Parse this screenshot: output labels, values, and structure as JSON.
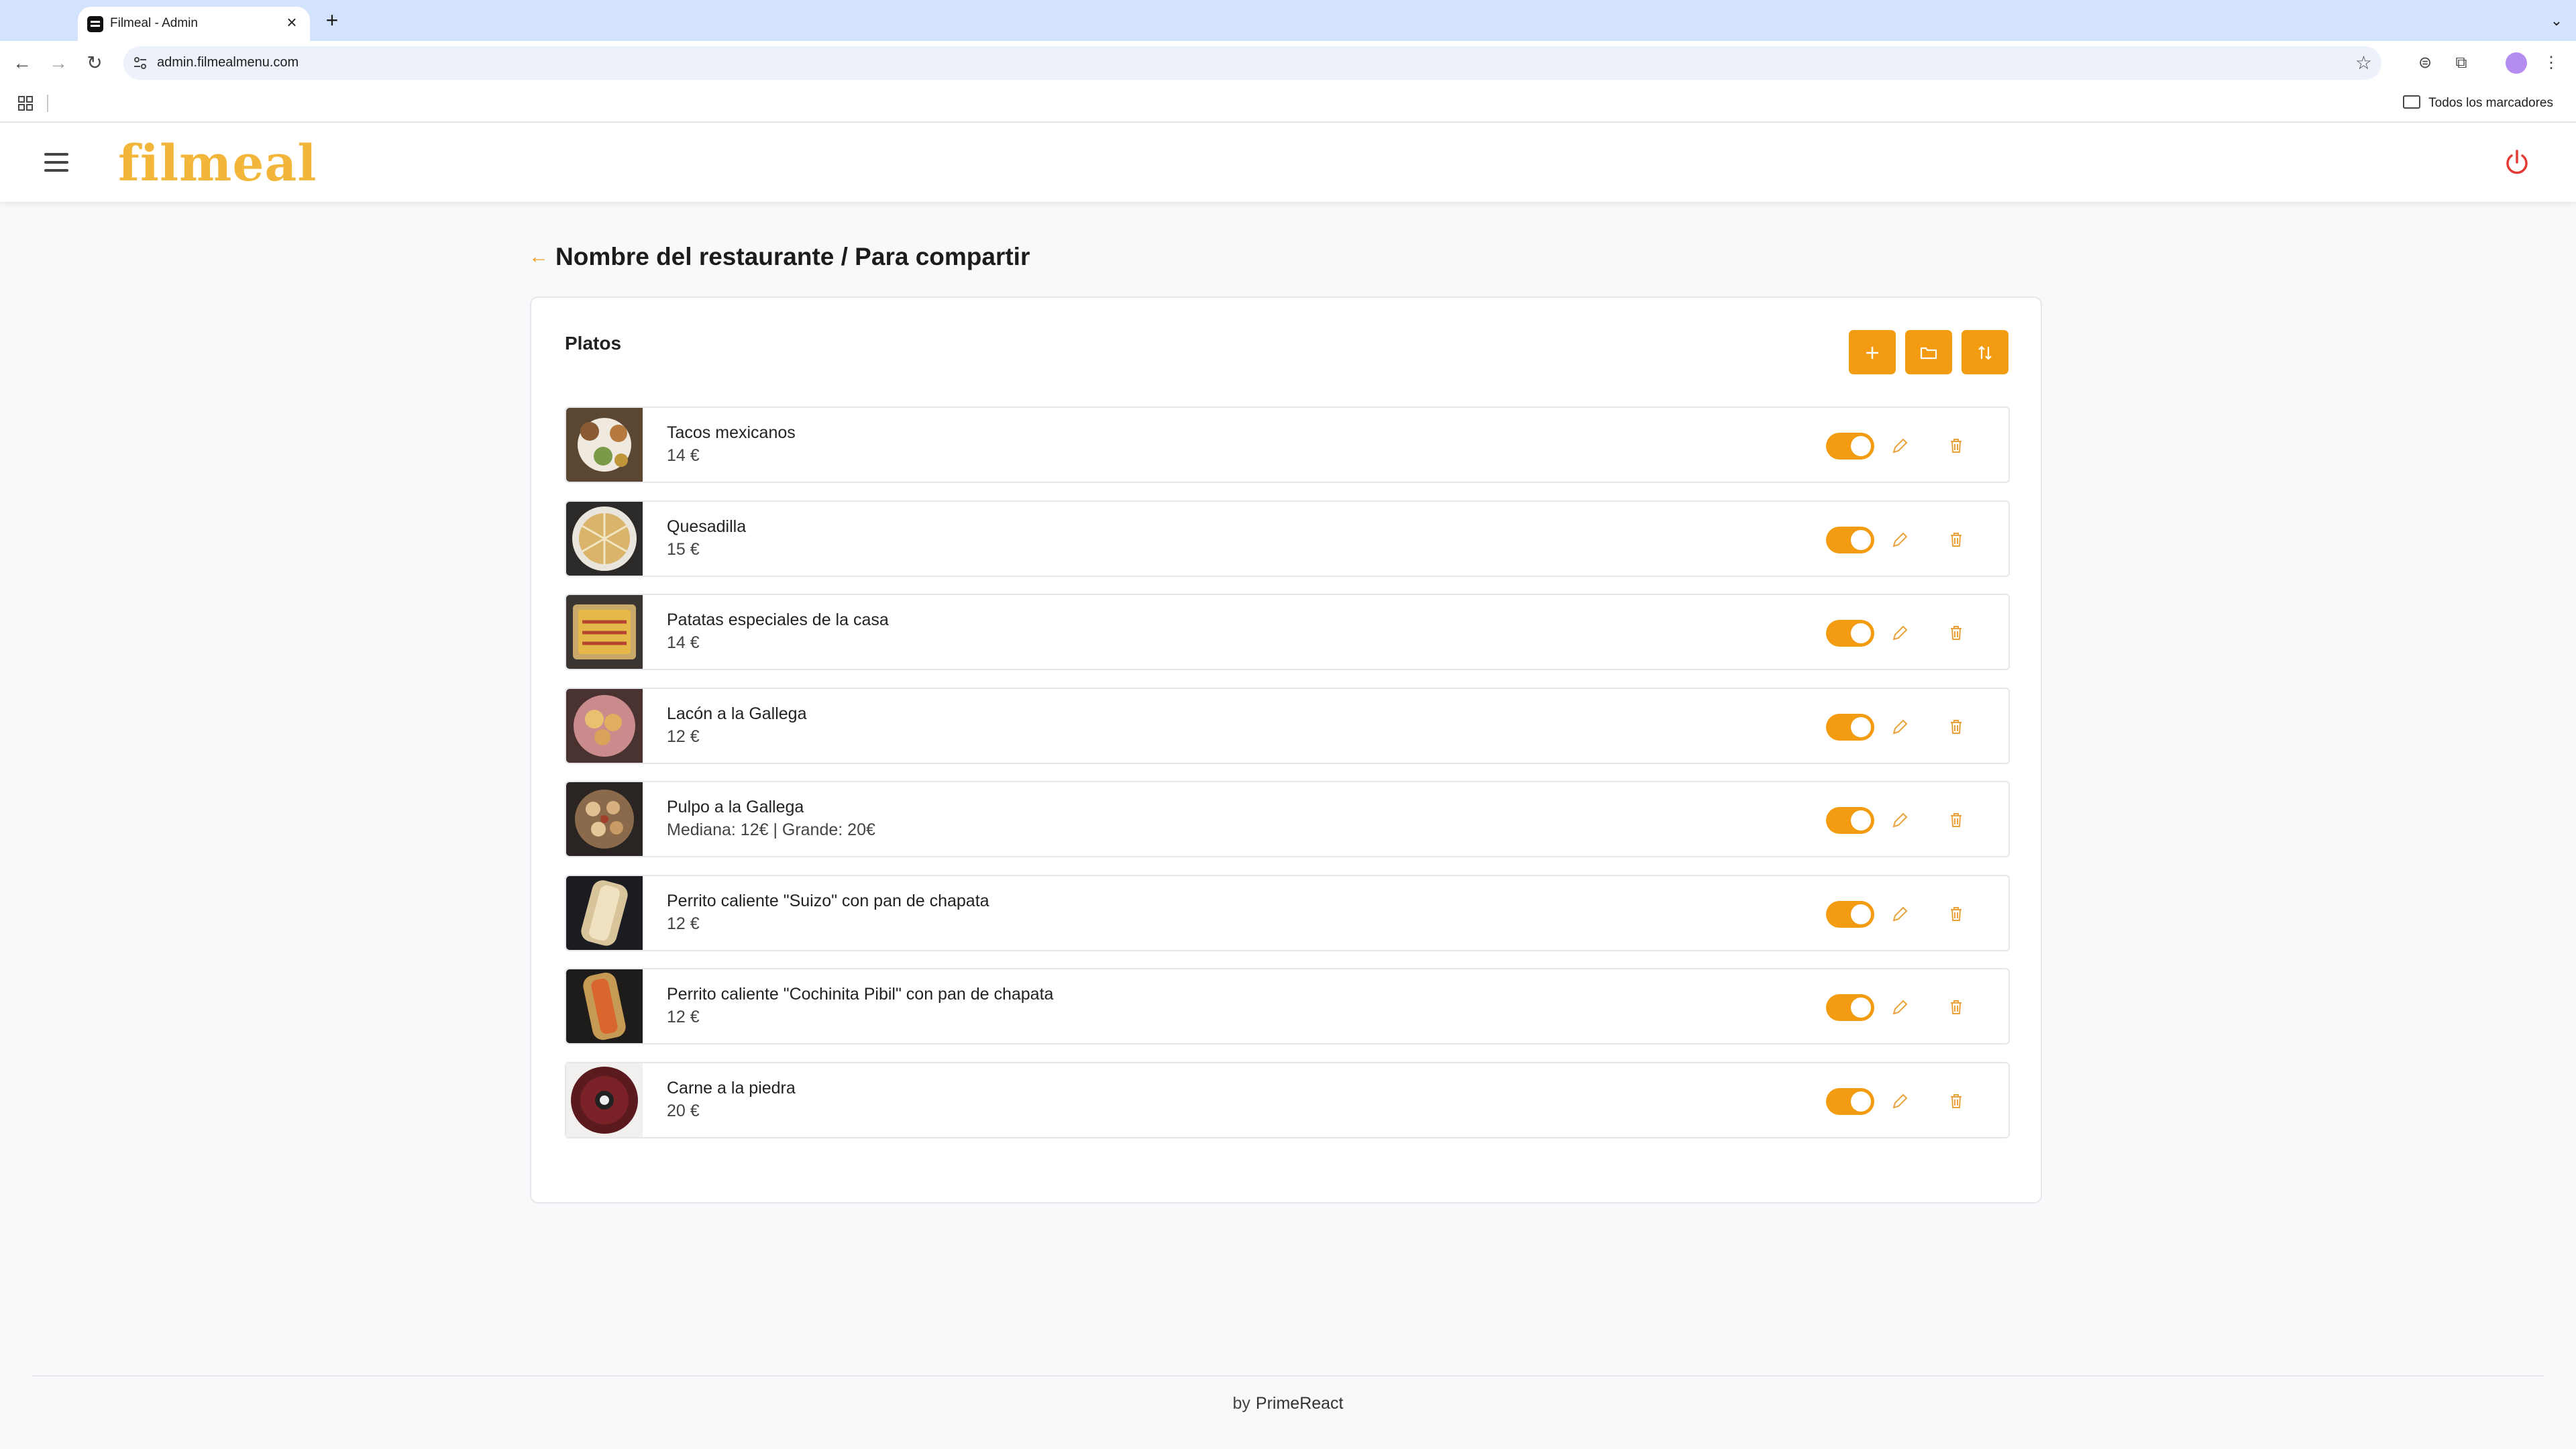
{
  "browser": {
    "tab_title": "Filmeal - Admin",
    "url": "admin.filmealmenu.com",
    "bookmarks_label": "Todos los marcadores"
  },
  "app": {
    "logo": "filmeal",
    "page_title": "Nombre del restaurante / Para compartir",
    "section_title": "Platos"
  },
  "dishes": [
    {
      "name": "Tacos mexicanos",
      "price": "14 €",
      "enabled": true
    },
    {
      "name": "Quesadilla",
      "price": "15 €",
      "enabled": true
    },
    {
      "name": "Patatas especiales de la casa",
      "price": "14 €",
      "enabled": true
    },
    {
      "name": "Lacón a la Gallega",
      "price": "12 €",
      "enabled": true
    },
    {
      "name": "Pulpo a la Gallega",
      "price": "Mediana: 12€ | Grande: 20€",
      "enabled": true
    },
    {
      "name": "Perrito caliente \"Suizo\" con pan de chapata",
      "price": "12 €",
      "enabled": true
    },
    {
      "name": "Perrito caliente \"Cochinita Pibil\" con pan de chapata",
      "price": "12 €",
      "enabled": true
    },
    {
      "name": "Carne a la piedra",
      "price": "20 €",
      "enabled": true
    }
  ],
  "footer": {
    "by": "by",
    "brand": "PrimeReact"
  },
  "colors": {
    "accent": "#f39c12",
    "logo": "#f2b63a",
    "power": "#e53935"
  }
}
